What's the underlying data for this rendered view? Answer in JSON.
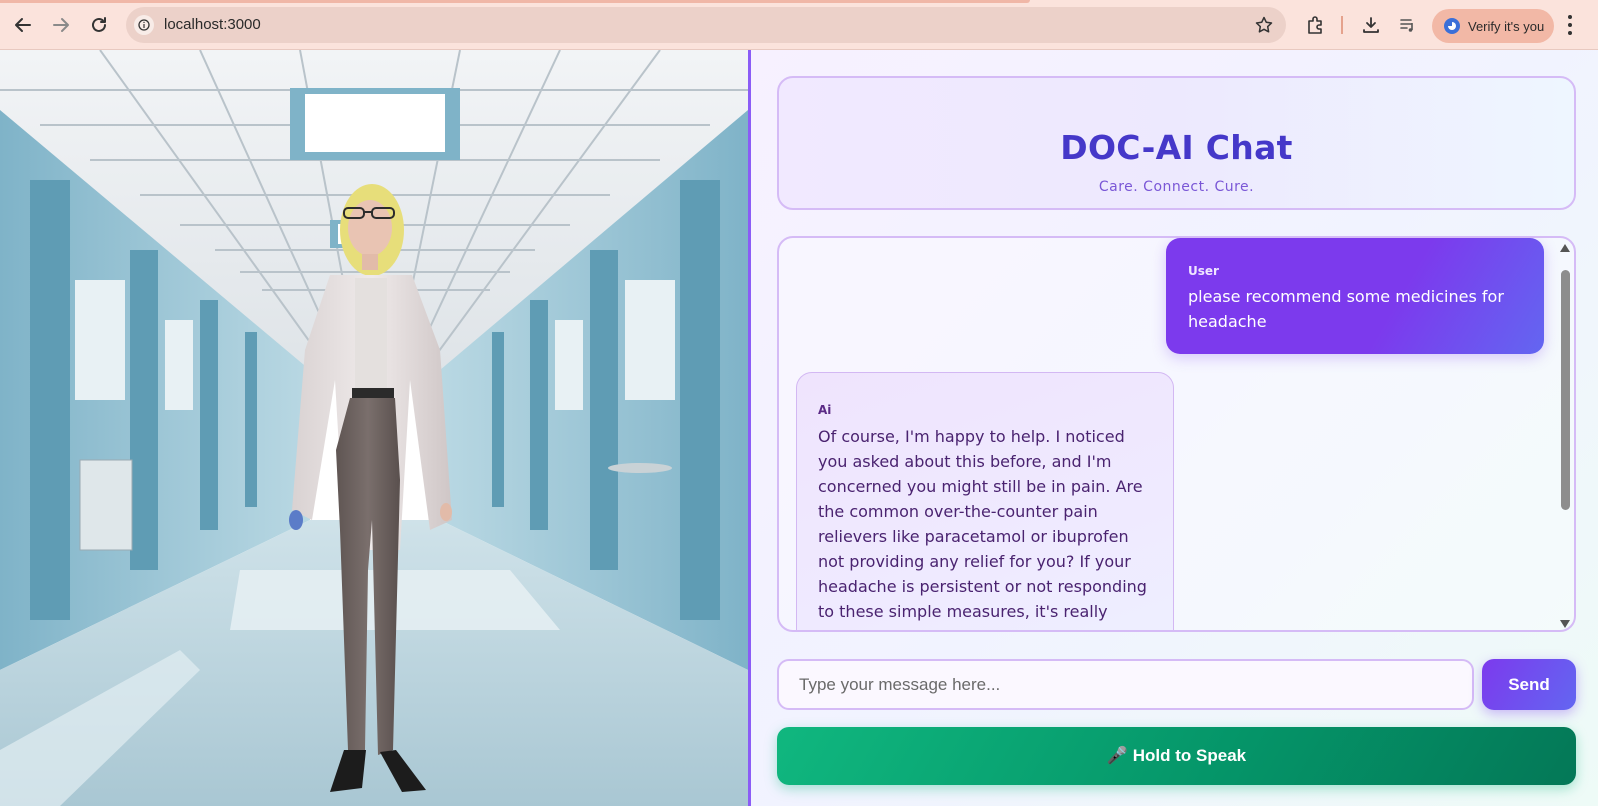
{
  "browser": {
    "url": "localhost:3000",
    "verify_label": "Verify it's you",
    "icons": [
      "back-arrow-icon",
      "forward-arrow-icon",
      "reload-icon",
      "site-info-icon",
      "bookmark-star-icon",
      "extensions-icon",
      "download-icon",
      "media-playlist-icon",
      "profile-icon",
      "more-menu-icon"
    ]
  },
  "header": {
    "title": "DOC-AI Chat",
    "tagline": "Care. Connect. Cure."
  },
  "messages": [
    {
      "role": "User",
      "text": "please recommend some medicines for headache"
    },
    {
      "role": "Ai",
      "text": "Of course, I'm happy to help. I noticed you asked about this before, and I'm concerned you might still be in pain. Are the common over-the-counter pain relievers like paracetamol or ibuprofen not providing any relief for you? If your headache is persistent or not responding to these simple measures, it's really important to see a doctor in person. They can help figure out the specific"
    }
  ],
  "composer": {
    "placeholder": "Type your message here...",
    "send_label": "Send",
    "speak_label": "🎤 Hold to Speak"
  },
  "colors": {
    "accent": "#7c3aed",
    "title": "#4538c9",
    "speak": "#059669",
    "border": "#d5bbf6"
  }
}
